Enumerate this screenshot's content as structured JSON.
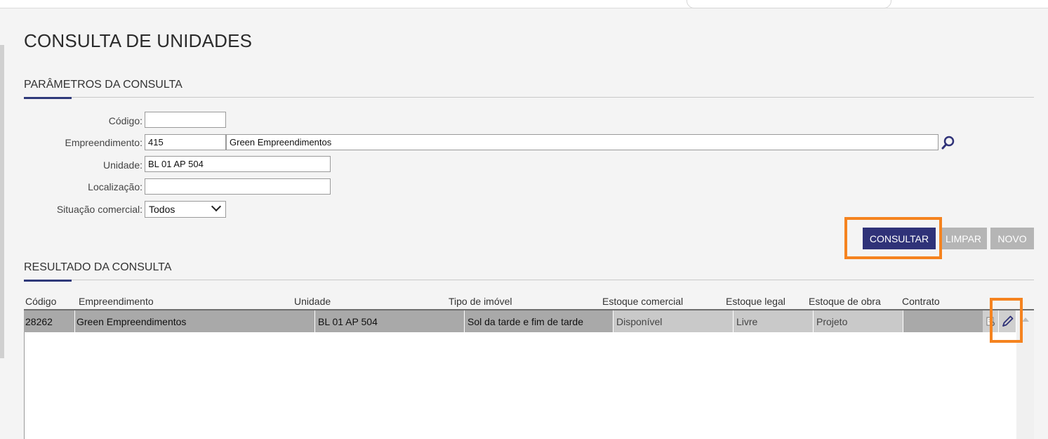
{
  "page": {
    "title": "CONSULTA DE UNIDADES"
  },
  "params": {
    "section_title": "PARÂMETROS DA CONSULTA",
    "codigo": {
      "label": "Código:",
      "value": ""
    },
    "empreendimento": {
      "label": "Empreendimento:",
      "code": "415",
      "name": "Green Empreendimentos"
    },
    "unidade": {
      "label": "Unidade:",
      "value": "BL 01 AP 504"
    },
    "localizacao": {
      "label": "Localização:",
      "value": ""
    },
    "situacao": {
      "label": "Situação comercial:",
      "selected": "Todos"
    }
  },
  "actions": {
    "consultar": "CONSULTAR",
    "limpar": "LIMPAR",
    "novo": "NOVO"
  },
  "results": {
    "section_title": "RESULTADO DA CONSULTA",
    "columns": [
      "Código",
      "Empreendimento",
      "Unidade",
      "Tipo de imóvel",
      "Estoque comercial",
      "Estoque legal",
      "Estoque de obra",
      "Contrato"
    ],
    "rows": [
      {
        "codigo": "28262",
        "empreendimento": "Green Empreendimentos",
        "unidade": "BL 01 AP 504",
        "tipo": "Sol da tarde e fim de tarde",
        "estoque_comercial": "Disponível",
        "estoque_legal": "Livre",
        "estoque_obra": "Projeto",
        "contrato": ""
      }
    ]
  },
  "icons": {
    "search": "magnifier-icon",
    "view": "view-document-icon",
    "edit": "pencil-icon",
    "dropdown": "chevron-down-icon"
  },
  "colors": {
    "primary": "#2f3278",
    "highlight": "#f5831f",
    "disabled": "#b5b5b5"
  }
}
